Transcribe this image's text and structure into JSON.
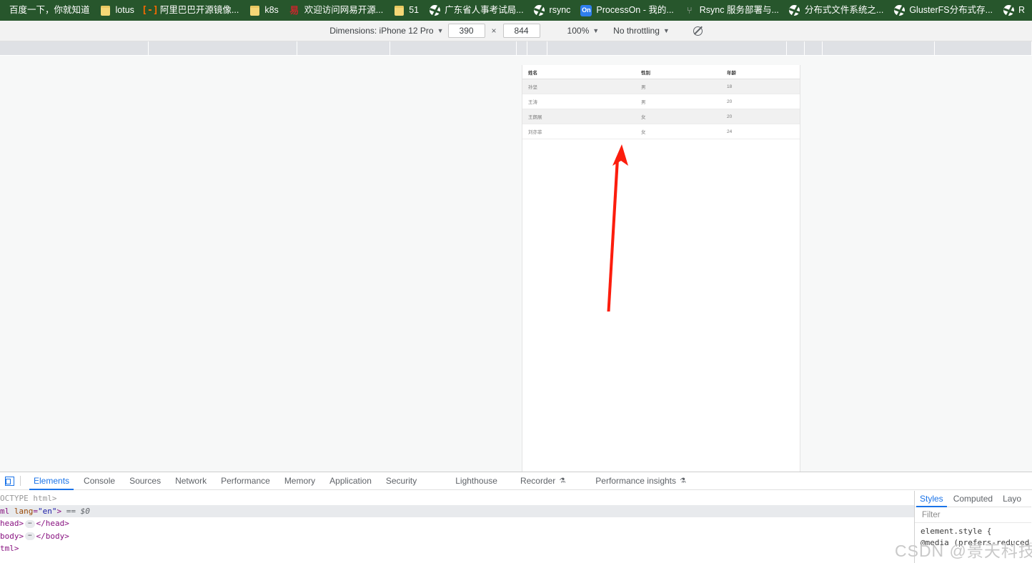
{
  "bookmarks": {
    "items": [
      {
        "label": "百度一下，你就知道",
        "icon": "none"
      },
      {
        "label": "lotus",
        "icon": "folder-icon"
      },
      {
        "label": "阿里巴巴开源镜像...",
        "icon": "alibaba-icon"
      },
      {
        "label": "k8s",
        "icon": "folder-icon"
      },
      {
        "label": "欢迎访问网易开源...",
        "icon": "netease-icon"
      },
      {
        "label": "51",
        "icon": "folder-icon"
      },
      {
        "label": "广东省人事考试局...",
        "icon": "globe-icon"
      },
      {
        "label": "rsync",
        "icon": "globe-icon"
      },
      {
        "label": "ProcessOn - 我的...",
        "icon": "processon-icon"
      },
      {
        "label": "Rsync 服务部署与...",
        "icon": "rsync-icon"
      },
      {
        "label": "分布式文件系统之...",
        "icon": "globe-icon"
      },
      {
        "label": "GlusterFS分布式存...",
        "icon": "globe-icon"
      },
      {
        "label": "R",
        "icon": "globe-icon"
      }
    ]
  },
  "device_toolbar": {
    "dimensions_label": "Dimensions: iPhone 12 Pro",
    "width_value": "390",
    "width_placeholder": "390",
    "height_value": "844",
    "height_placeholder": "844",
    "multiply_symbol": "×",
    "zoom_label": "100%",
    "throttling_label": "No throttling",
    "caret": "▼",
    "rotate_icon": "rotate-device-icon"
  },
  "page": {
    "table": {
      "headers": [
        "姓名",
        "性别",
        "年龄"
      ],
      "rows": [
        {
          "name": "孙坚",
          "gender": "男",
          "age": "18"
        },
        {
          "name": "王涛",
          "gender": "男",
          "age": "20"
        },
        {
          "name": "王朗展",
          "gender": "女",
          "age": "20"
        },
        {
          "name": "刘亦菲",
          "gender": "女",
          "age": "24"
        }
      ]
    },
    "annotation": {
      "type": "red-arrow",
      "color": "#fc1d0d",
      "direction": "up"
    }
  },
  "devtools": {
    "inspect_icon": "device-toolbar-toggle-icon",
    "tabs": [
      {
        "label": "Elements",
        "active": true,
        "badge": ""
      },
      {
        "label": "Console",
        "active": false,
        "badge": ""
      },
      {
        "label": "Sources",
        "active": false,
        "badge": ""
      },
      {
        "label": "Network",
        "active": false,
        "badge": ""
      },
      {
        "label": "Performance",
        "active": false,
        "badge": ""
      },
      {
        "label": "Memory",
        "active": false,
        "badge": ""
      },
      {
        "label": "Application",
        "active": false,
        "badge": ""
      },
      {
        "label": "Security",
        "active": false,
        "badge": ""
      },
      {
        "label": "Lighthouse",
        "active": false,
        "badge": ""
      },
      {
        "label": "Recorder",
        "active": false,
        "badge": "⚗"
      },
      {
        "label": "Performance insights",
        "active": false,
        "badge": "⚗"
      }
    ],
    "dom": {
      "line1": "OCTYPE html>",
      "line2_tag": "ml ",
      "line2_attr": "lang",
      "line2_eq": "=",
      "line2_val": "\"en\"",
      "line2_close": ">",
      "line2_selected": "== $0",
      "line3_open": "head>",
      "line3_close": "</head>",
      "line4_open": "body>",
      "line4_close": "</body>",
      "line5": "tml>",
      "pill": "⋯"
    },
    "styles": {
      "tabs": [
        {
          "label": "Styles",
          "active": true
        },
        {
          "label": "Computed",
          "active": false
        },
        {
          "label": "Layo",
          "active": false
        }
      ],
      "filter_placeholder": "Filter",
      "rules": [
        "element.style {",
        "@media (prefers-reduced-"
      ]
    }
  },
  "watermark": {
    "text": "CSDN @景天科技苑"
  },
  "colors": {
    "bookmark_bar_bg": "#27562c",
    "accent_blue": "#1a73e8",
    "toolbar_bg": "#f2f2f2",
    "ruler_bg": "#dfe1e5",
    "stage_bg": "#f7f8f8",
    "arrow_red": "#fc1d0d"
  }
}
